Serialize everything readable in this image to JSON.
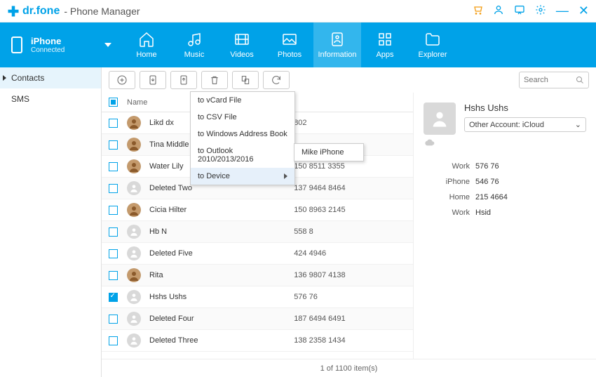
{
  "titlebar": {
    "brand": "dr.fone",
    "app_name": "- Phone Manager"
  },
  "device": {
    "name": "iPhone",
    "status": "Connected"
  },
  "nav": {
    "items": [
      {
        "label": "Home"
      },
      {
        "label": "Music"
      },
      {
        "label": "Videos"
      },
      {
        "label": "Photos"
      },
      {
        "label": "Information"
      },
      {
        "label": "Apps"
      },
      {
        "label": "Explorer"
      }
    ]
  },
  "sidebar": {
    "items": [
      {
        "label": "Contacts"
      },
      {
        "label": "SMS"
      }
    ]
  },
  "search": {
    "placeholder": "Search"
  },
  "table": {
    "header_name": "Name",
    "rows": [
      {
        "name": "Likd dx",
        "phone": "802",
        "checked": false
      },
      {
        "name": "Tina Middle lau",
        "phone": "",
        "checked": false
      },
      {
        "name": "Water Lily",
        "phone": "150 8511 3355",
        "checked": false
      },
      {
        "name": "Deleted Two",
        "phone": "137 9464 8464",
        "checked": false
      },
      {
        "name": "Cicia Hilter",
        "phone": "150 8963 2145",
        "checked": false
      },
      {
        "name": "Hb N",
        "phone": "558 8",
        "checked": false
      },
      {
        "name": "Deleted Five",
        "phone": "424 4946",
        "checked": false
      },
      {
        "name": "Rita",
        "phone": "136 9807 4138",
        "checked": false
      },
      {
        "name": "Hshs Ushs",
        "phone": "576 76",
        "checked": true
      },
      {
        "name": "Deleted Four",
        "phone": "187 6494 6491",
        "checked": false
      },
      {
        "name": "Deleted Three",
        "phone": "138 2358 1434",
        "checked": false
      }
    ]
  },
  "export_menu": {
    "items": [
      {
        "label": "to vCard File"
      },
      {
        "label": "to CSV File"
      },
      {
        "label": "to Windows Address Book"
      },
      {
        "label": "to Outlook 2010/2013/2016"
      },
      {
        "label": "to Device"
      }
    ],
    "submenu": [
      {
        "label": "Mike iPhone"
      }
    ]
  },
  "detail": {
    "name": "Hshs Ushs",
    "account": "Other Account: iCloud",
    "fields": [
      {
        "label": "Work",
        "value": "576 76"
      },
      {
        "label": "iPhone",
        "value": "546 76"
      },
      {
        "label": "Home",
        "value": "215 4664"
      },
      {
        "label": "Work",
        "value": "Hsid"
      }
    ]
  },
  "status": {
    "text": "1 of 1100 item(s)"
  }
}
